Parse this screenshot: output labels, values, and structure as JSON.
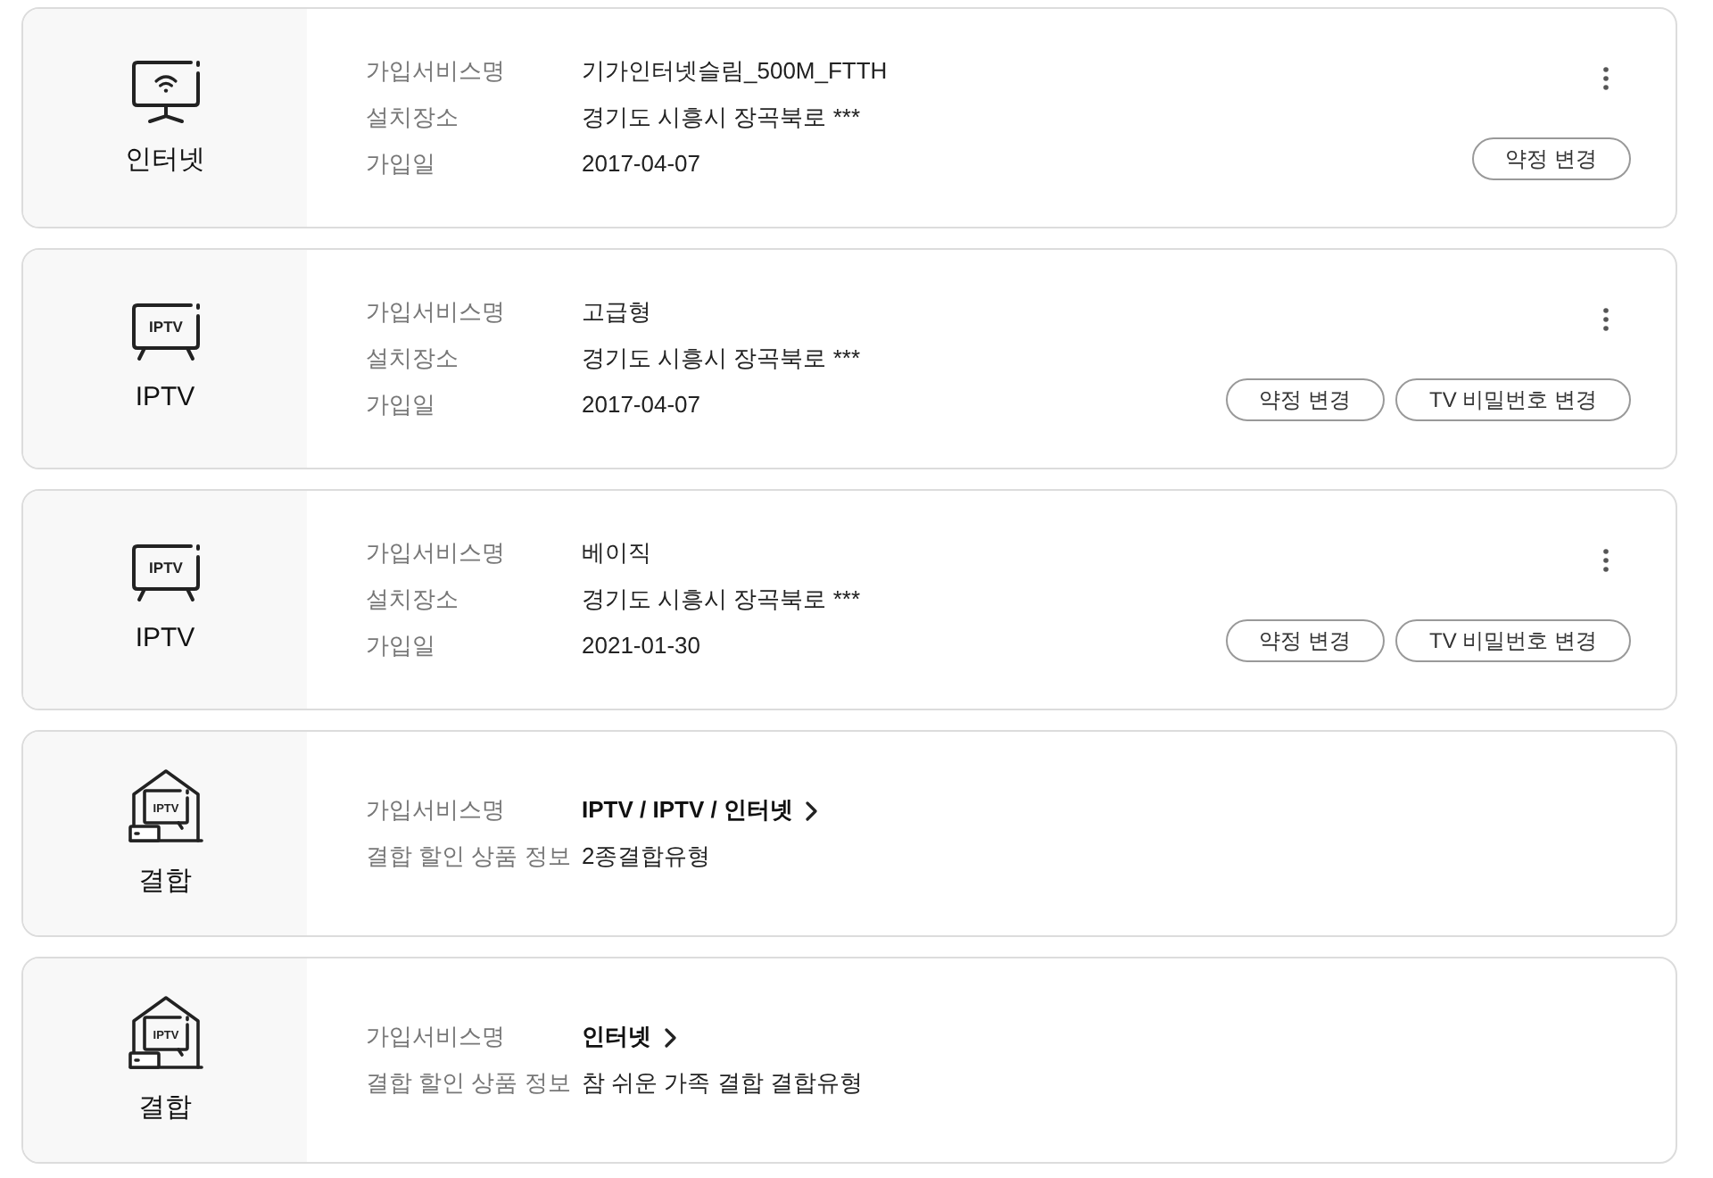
{
  "services": [
    {
      "kind": "internet",
      "category": "인터넷",
      "has_menu": true,
      "rows": [
        {
          "label": "가입서비스명",
          "value": "기가인터넷슬림_500M_FTTH",
          "link": false
        },
        {
          "label": "설치장소",
          "value": "경기도 시흥시 장곡북로 ***",
          "link": false
        },
        {
          "label": "가입일",
          "value": "2017-04-07",
          "link": false
        }
      ],
      "buttons": [
        "약정 변경"
      ]
    },
    {
      "kind": "iptv",
      "screen_text": "IPTV",
      "category": "IPTV",
      "has_menu": true,
      "rows": [
        {
          "label": "가입서비스명",
          "value": "고급형",
          "link": false
        },
        {
          "label": "설치장소",
          "value": "경기도 시흥시 장곡북로 ***",
          "link": false
        },
        {
          "label": "가입일",
          "value": "2017-04-07",
          "link": false
        }
      ],
      "buttons": [
        "약정 변경",
        "TV 비밀번호 변경"
      ]
    },
    {
      "kind": "iptv",
      "screen_text": "IPTV",
      "category": "IPTV",
      "has_menu": true,
      "rows": [
        {
          "label": "가입서비스명",
          "value": "베이직",
          "link": false
        },
        {
          "label": "설치장소",
          "value": "경기도 시흥시 장곡북로 ***",
          "link": false
        },
        {
          "label": "가입일",
          "value": "2021-01-30",
          "link": false
        }
      ],
      "buttons": [
        "약정 변경",
        "TV 비밀번호 변경"
      ]
    },
    {
      "kind": "bundle",
      "screen_text": "IPTV",
      "category": "결합",
      "has_menu": false,
      "rows": [
        {
          "label": "가입서비스명",
          "value": "IPTV / IPTV / 인터넷",
          "link": true
        },
        {
          "label": "결합 할인 상품 정보",
          "value": "2종결합유형",
          "link": false
        }
      ]
    },
    {
      "kind": "bundle",
      "screen_text": "IPTV",
      "category": "결합",
      "has_menu": false,
      "rows": [
        {
          "label": "가입서비스명",
          "value": "인터넷",
          "link": true
        },
        {
          "label": "결합 할인 상품 정보",
          "value": "참 쉬운 가족 결합 결합유형",
          "link": false
        }
      ]
    }
  ]
}
